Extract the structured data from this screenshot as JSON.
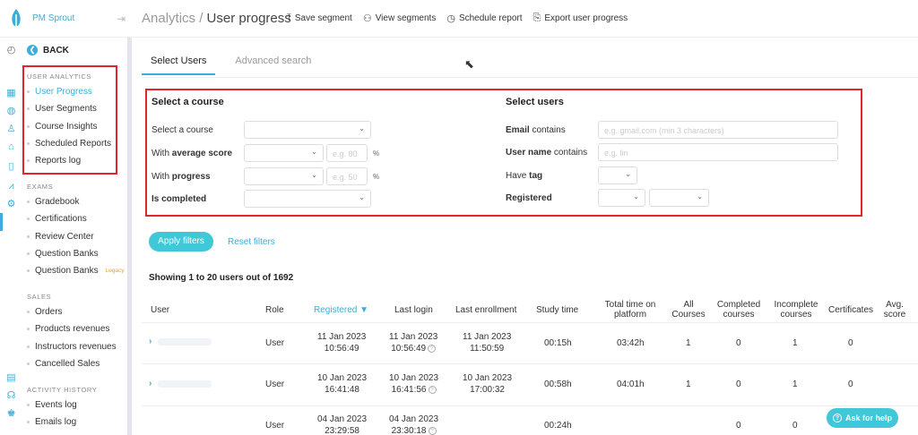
{
  "app": {
    "name": "PM Sprout"
  },
  "header": {
    "breadcrumb_parent": "Analytics",
    "breadcrumb_sep": " / ",
    "title": "User progress",
    "actions": [
      {
        "label": "Save segment",
        "icon": "upload-icon"
      },
      {
        "label": "View segments",
        "icon": "users-icon"
      },
      {
        "label": "Schedule report",
        "icon": "clock-icon"
      },
      {
        "label": "Export user progress",
        "icon": "export-icon"
      }
    ]
  },
  "sidebar": {
    "back_label": "BACK",
    "sections": {
      "user_analytics": "USER ANALYTICS",
      "exams": "EXAMS",
      "sales": "SALES",
      "activity": "ACTIVITY HISTORY"
    },
    "user_analytics_items": [
      "User Progress",
      "User Segments",
      "Course Insights",
      "Scheduled Reports",
      "Reports log"
    ],
    "exams_items": [
      "Gradebook",
      "Certifications",
      "Review Center",
      "Question Banks",
      "Question Banks"
    ],
    "legacy_badge": "Legacy",
    "sales_items": [
      "Orders",
      "Products revenues",
      "Instructors revenues",
      "Cancelled Sales"
    ],
    "activity_items": [
      "Events log",
      "Emails log"
    ]
  },
  "tabs": [
    "Select Users",
    "Advanced search"
  ],
  "filters": {
    "course": {
      "title": "Select a course",
      "select_course": "Select a course",
      "avg_prefix": "With ",
      "avg_bold": "average score",
      "avg_placeholder": "e.g. 80",
      "progress_prefix": "With ",
      "progress_bold": "progress",
      "progress_placeholder": "e.g. 50",
      "percent": "%",
      "completed_bold": "Is completed"
    },
    "users": {
      "title": "Select users",
      "email_bold": "Email",
      "email_suffix": " contains",
      "email_placeholder": "e.g. gmail.com (min 3 characters)",
      "username_bold": "User name",
      "username_suffix": " contains",
      "username_placeholder": "e.g. lin",
      "tag_prefix": "Have ",
      "tag_bold": "tag",
      "registered_bold": "Registered"
    }
  },
  "buttons": {
    "apply": "Apply filters",
    "reset": "Reset filters",
    "help": "Ask for help"
  },
  "results_summary": "Showing 1 to 20 users out of 1692",
  "table": {
    "columns": [
      "User",
      "Role",
      "Registered ▼",
      "Last login",
      "Last enrollment",
      "Study time",
      "Total time on platform",
      "All Courses",
      "Completed courses",
      "Incomplete courses",
      "Certificates",
      "Avg. score"
    ],
    "rows": [
      {
        "role": "User",
        "reg_date": "11 Jan 2023",
        "reg_time": "10:56:49",
        "login_date": "11 Jan 2023",
        "login_time": "10:56:49",
        "enr_date": "11 Jan 2023",
        "enr_time": "11:50:59",
        "study": "00:15h",
        "total": "03:42h",
        "all": "1",
        "completed": "0",
        "incomplete": "1",
        "certs": "0"
      },
      {
        "role": "User",
        "reg_date": "10 Jan 2023",
        "reg_time": "16:41:48",
        "login_date": "10 Jan 2023",
        "login_time": "16:41:56",
        "enr_date": "10 Jan 2023",
        "enr_time": "17:00:32",
        "study": "00:58h",
        "total": "04:01h",
        "all": "1",
        "completed": "0",
        "incomplete": "1",
        "certs": "0"
      },
      {
        "role": "User",
        "reg_date": "04 Jan 2023",
        "reg_time": "23:29:58",
        "login_date": "04 Jan 2023",
        "login_time": "23:30:18",
        "enr_date": "",
        "enr_time": "",
        "study": "00:24h",
        "total": "",
        "all": "",
        "completed": "0",
        "incomplete": "0",
        "certs": ""
      }
    ]
  },
  "colors": {
    "accent": "#3aaed8",
    "button": "#40c7d8",
    "highlight": "#e0262b"
  }
}
